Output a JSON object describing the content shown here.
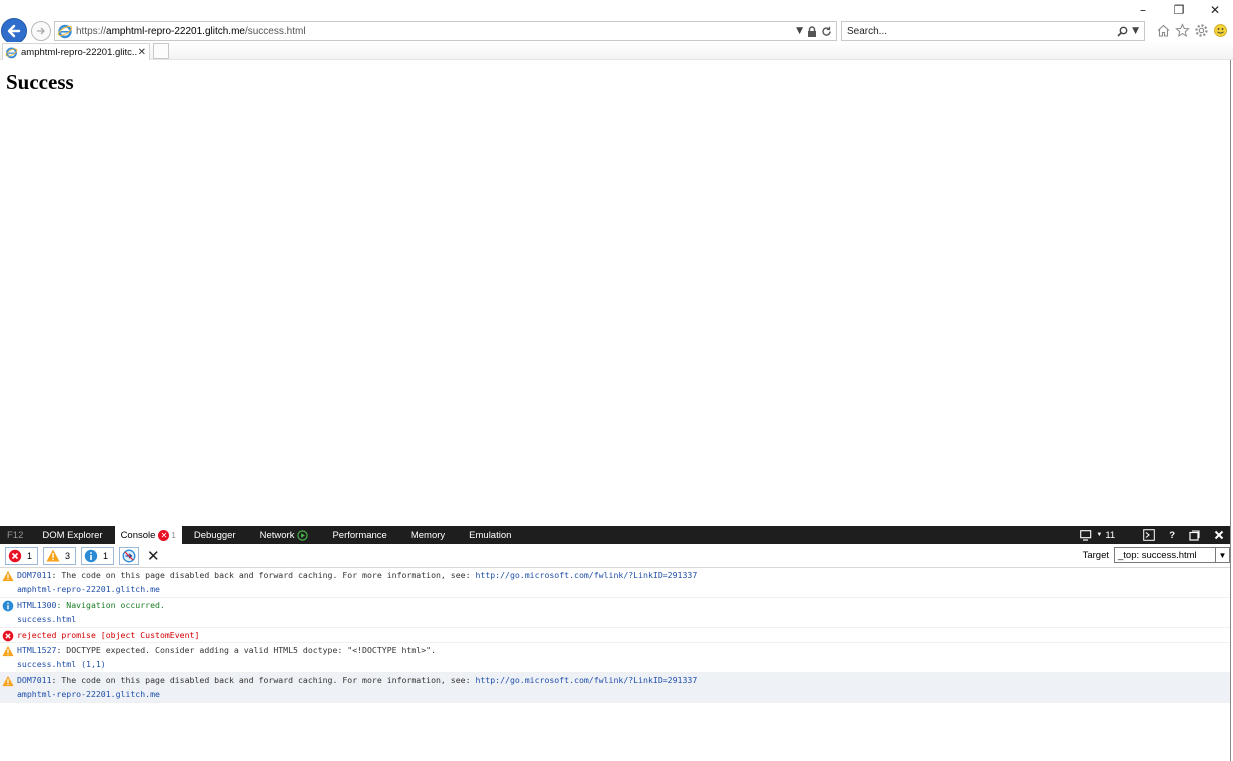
{
  "window": {
    "minimize": "–",
    "restore": "❐",
    "close": "✕"
  },
  "nav": {
    "url_prefix": "https://",
    "url_host": "amphtml-repro-22201.glitch.me",
    "url_path": "/success.html",
    "search_placeholder": "Search..."
  },
  "tab": {
    "title": "amphtml-repro-22201.glitc...",
    "close": "✕"
  },
  "page": {
    "heading": "Success"
  },
  "devtools": {
    "tabs": {
      "f12": "F12",
      "dom": "DOM Explorer",
      "console": "Console",
      "console_badge": "1",
      "debugger": "Debugger",
      "network": "Network",
      "performance": "Performance",
      "memory": "Memory",
      "emulation": "Emulation"
    },
    "doc_mode": "11",
    "help": "?",
    "filters": {
      "errors": "1",
      "warnings": "3",
      "info": "1"
    },
    "target_label": "Target",
    "target_value": "_top: success.html",
    "messages": [
      {
        "type": "warning",
        "code": "DOM7011",
        "text": ": The code on this page disabled back and forward caching. For more information, see: ",
        "link": "http://go.microsoft.com/fwlink/?LinkID=291337",
        "source": "amphtml-repro-22201.glitch.me"
      },
      {
        "type": "info",
        "code": "HTML1300",
        "text": ": Navigation occurred.",
        "source": "success.html"
      },
      {
        "type": "error",
        "text": "rejected promise [object CustomEvent]"
      },
      {
        "type": "warning",
        "code": "HTML1527",
        "text": ": DOCTYPE expected. Consider adding a valid HTML5 doctype: \"<!DOCTYPE html>\".",
        "source": "success.html (1,1)"
      },
      {
        "type": "warning",
        "code": "DOM7011",
        "text": ": The code on this page disabled back and forward caching. For more information, see: ",
        "link": "http://go.microsoft.com/fwlink/?LinkID=291337",
        "source": "amphtml-repro-22201.glitch.me"
      }
    ]
  }
}
